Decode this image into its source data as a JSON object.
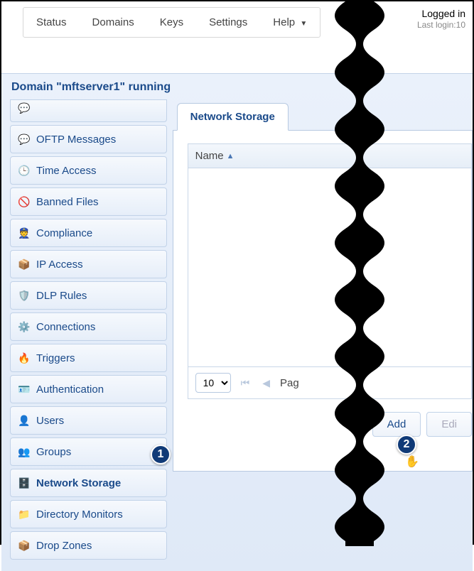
{
  "menu": {
    "status": "Status",
    "domains": "Domains",
    "keys": "Keys",
    "settings": "Settings",
    "help": "Help"
  },
  "login": {
    "logged_in": "Logged in",
    "last_login": "Last login:10"
  },
  "domain_title": "Domain \"mftserver1\" running",
  "sidebar": {
    "items": [
      {
        "label": "",
        "icon": "💬"
      },
      {
        "label": "OFTP Messages",
        "icon": "💬"
      },
      {
        "label": "Time Access",
        "icon": "🕒"
      },
      {
        "label": "Banned Files",
        "icon": "🚫"
      },
      {
        "label": "Compliance",
        "icon": "👮"
      },
      {
        "label": "IP Access",
        "icon": "📦"
      },
      {
        "label": "DLP Rules",
        "icon": "🛡️"
      },
      {
        "label": "Connections",
        "icon": "⚙️"
      },
      {
        "label": "Triggers",
        "icon": "🔥"
      },
      {
        "label": "Authentication",
        "icon": "🪪"
      },
      {
        "label": "Users",
        "icon": "👤"
      },
      {
        "label": "Groups",
        "icon": "👥"
      },
      {
        "label": "Network Storage",
        "icon": "🗄️"
      },
      {
        "label": "Directory Monitors",
        "icon": "📁"
      },
      {
        "label": "Drop Zones",
        "icon": "📦"
      }
    ]
  },
  "tab": {
    "label": "Network Storage"
  },
  "grid": {
    "col_name": "Name",
    "page_size": "10",
    "page_label": "Pag"
  },
  "buttons": {
    "add": "Add",
    "edit": "Edi"
  },
  "callouts": {
    "one": "1",
    "two": "2"
  }
}
